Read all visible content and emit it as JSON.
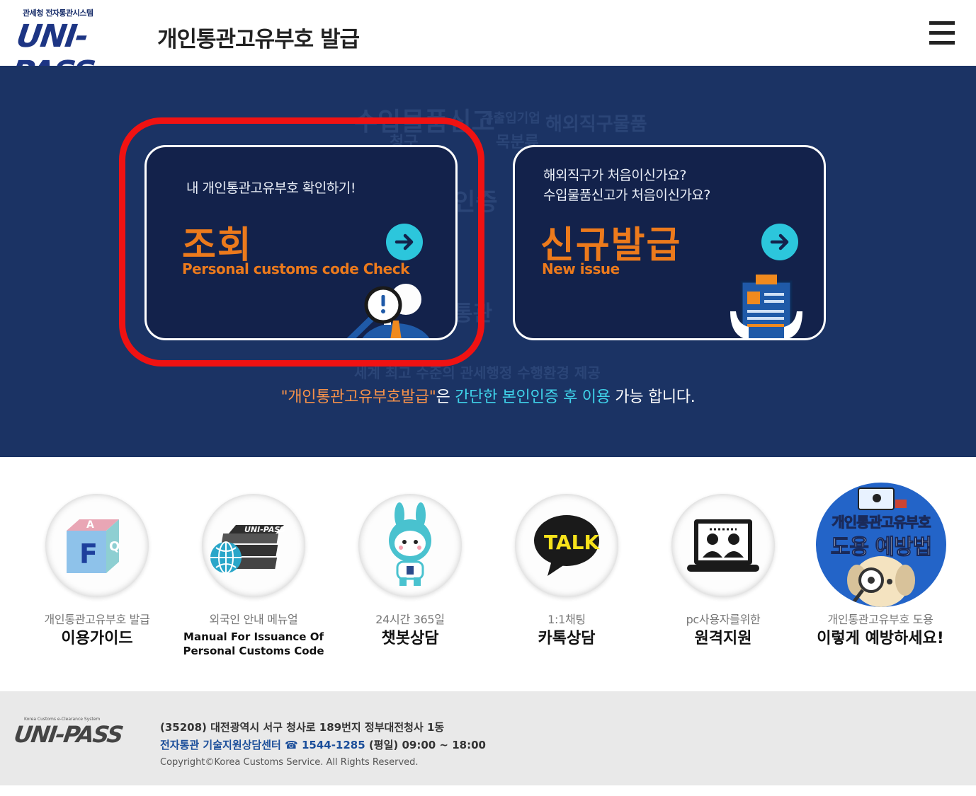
{
  "header": {
    "logo_sub": "관세청 전자통관시스템",
    "logo_main": "UNI-PASS",
    "title": "개인통관고유부호 발급",
    "menu_icon": "hamburger-menu-icon"
  },
  "hero": {
    "background_words": [
      "수입물품신고",
      "수출입기업",
      "해외직구물품",
      "인증",
      "통관",
      "청구",
      "목분류",
      "세계 최고 수준의 관세행정 수행환경 제공"
    ],
    "check_card": {
      "lead": "내 개인통관고유부호 확인하기!",
      "title": "조회",
      "subtitle": "Personal customs code Check",
      "icon": "magnifier-person-icon",
      "arrow_icon": "arrow-right-icon"
    },
    "issue_card": {
      "lead_line1": "해외직구가 처음이신가요?",
      "lead_line2": "수입물품신고가 처음이신가요?",
      "title": "신규발급",
      "subtitle": "New issue",
      "icon": "clipboard-document-icon",
      "arrow_icon": "arrow-right-icon"
    },
    "notice": {
      "part1": "\"개인통관고유부호발급\"",
      "part2": "은 ",
      "part3": "간단한 본인인증 후 이용",
      "part4": " 가능 합니다."
    }
  },
  "quick_menu": [
    {
      "caption": "개인통관고유부호 발급",
      "label": "이용가이드",
      "icon": "faq-cube-icon"
    },
    {
      "caption": "외국인 안내 메뉴얼",
      "label_line1": "Manual For Issuance Of",
      "label_line2": "Personal Customs Code",
      "icon": "manual-books-globe-icon",
      "badge": "UNI-PASS"
    },
    {
      "caption": "24시간 365일",
      "label": "챗봇상담",
      "icon": "chatbot-rabbit-icon"
    },
    {
      "caption": "1:1채팅",
      "label": "카톡상담",
      "icon": "kakaotalk-icon",
      "badge": "TALK"
    },
    {
      "caption": "pc사용자를위한",
      "label": "원격지원",
      "icon": "remote-support-laptop-icon"
    },
    {
      "caption": "개인통관고유부호 도용",
      "label": "이렇게 예방하세요!",
      "icon": "theft-prevention-banner-icon",
      "banner_line1": "개인통관고유부호",
      "banner_line2": "도용 예방법"
    }
  ],
  "footer": {
    "logo_sub": "Korea Customs e-Clearance System",
    "logo_main": "UNI-PASS",
    "address": "(35208) 대전광역시 서구 청사로 189번지 정부대전청사 1동",
    "center": "전자통관 기술지원상담센터 ☎ 1544-1285",
    "hours": " (평일) 09:00 ~ 18:00",
    "copyright": "Copyright©Korea Customs Service. All Rights Reserved."
  },
  "colors": {
    "hero_bg": "#1b3364",
    "card_bg": "#13224b",
    "accent_orange": "#ec7a1c",
    "accent_cyan": "#2cc6dc",
    "highlight_red": "#f01212"
  }
}
